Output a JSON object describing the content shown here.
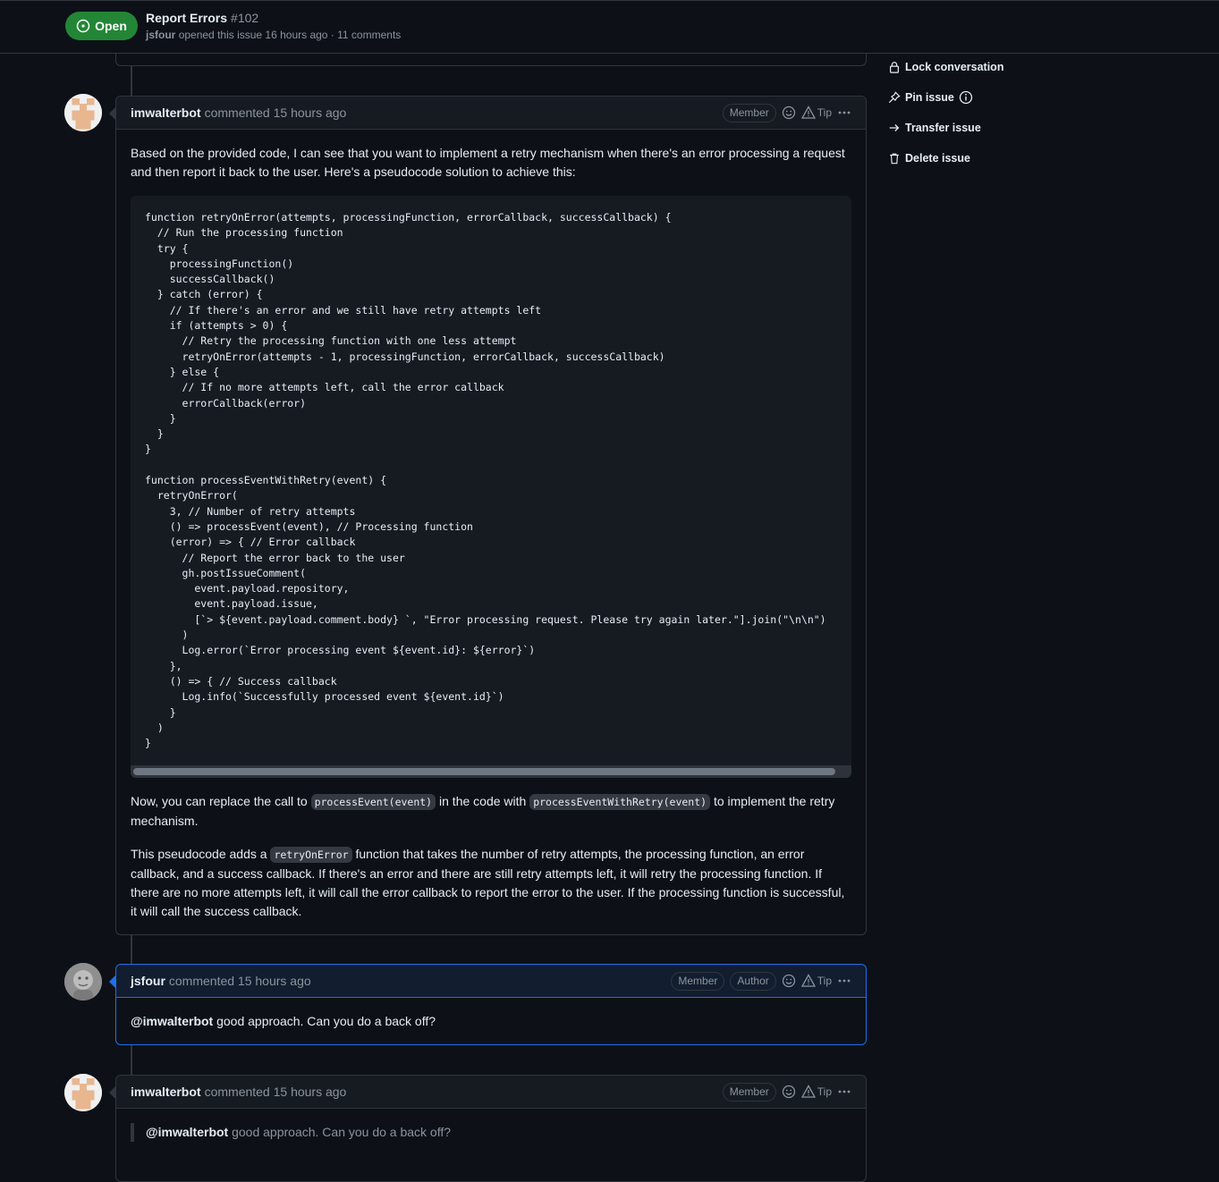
{
  "header": {
    "state": "Open",
    "title": "Report Errors",
    "number": "#102",
    "author": "jsfour",
    "meta_rest": "opened this issue 16 hours ago · 11 comments"
  },
  "sidebar": {
    "items": [
      {
        "label": "Lock conversation",
        "icon": "lock-icon"
      },
      {
        "label": "Pin issue",
        "icon": "pin-icon"
      },
      {
        "label": "Transfer issue",
        "icon": "arrow-right-icon"
      },
      {
        "label": "Delete issue",
        "icon": "trash-icon"
      }
    ]
  },
  "comments": [
    {
      "author": "imwalterbot",
      "when": "commented 15 hours ago",
      "badges": [
        "Member"
      ],
      "tip": "Tip",
      "intro": "Based on the provided code, I can see that you want to implement a retry mechanism when there's an error processing a request and then report it back to the user. Here's a pseudocode solution to achieve this:",
      "code": "function retryOnError(attempts, processingFunction, errorCallback, successCallback) {\n  // Run the processing function\n  try {\n    processingFunction()\n    successCallback()\n  } catch (error) {\n    // If there's an error and we still have retry attempts left\n    if (attempts > 0) {\n      // Retry the processing function with one less attempt\n      retryOnError(attempts - 1, processingFunction, errorCallback, successCallback)\n    } else {\n      // If no more attempts left, call the error callback\n      errorCallback(error)\n    }\n  }\n}\n\nfunction processEventWithRetry(event) {\n  retryOnError(\n    3, // Number of retry attempts\n    () => processEvent(event), // Processing function\n    (error) => { // Error callback\n      // Report the error back to the user\n      gh.postIssueComment(\n        event.payload.repository,\n        event.payload.issue,\n        [`> ${event.payload.comment.body} `, \"Error processing request. Please try again later.\"].join(\"\\n\\n\")\n      )\n      Log.error(`Error processing event ${event.id}: ${error}`)\n    },\n    () => { // Success callback\n      Log.info(`Successfully processed event ${event.id}`)\n    }\n  )\n}",
      "p2_a": "Now, you can replace the call to",
      "p2_code1": "processEvent(event)",
      "p2_b": "in the code with",
      "p2_code2": "processEventWithRetry(event)",
      "p2_c": "to implement the retry mechanism.",
      "p3_a": "This pseudocode adds a",
      "p3_code": "retryOnError",
      "p3_b": "function that takes the number of retry attempts, the processing function, an error callback, and a success callback. If there's an error and there are still retry attempts left, it will retry the processing function. If there are no more attempts left, it will call the error callback to report the error to the user. If the processing function is successful, it will call the success callback."
    },
    {
      "author": "jsfour",
      "when": "commented 15 hours ago",
      "badges": [
        "Member",
        "Author"
      ],
      "tip": "Tip",
      "mention": "@imwalterbot",
      "text": "good approach. Can you do a back off?"
    },
    {
      "author": "imwalterbot",
      "when": "commented 15 hours ago",
      "badges": [
        "Member"
      ],
      "tip": "Tip",
      "quote_mention": "@imwalterbot",
      "quote_text": "good approach. Can you do a back off?"
    }
  ]
}
